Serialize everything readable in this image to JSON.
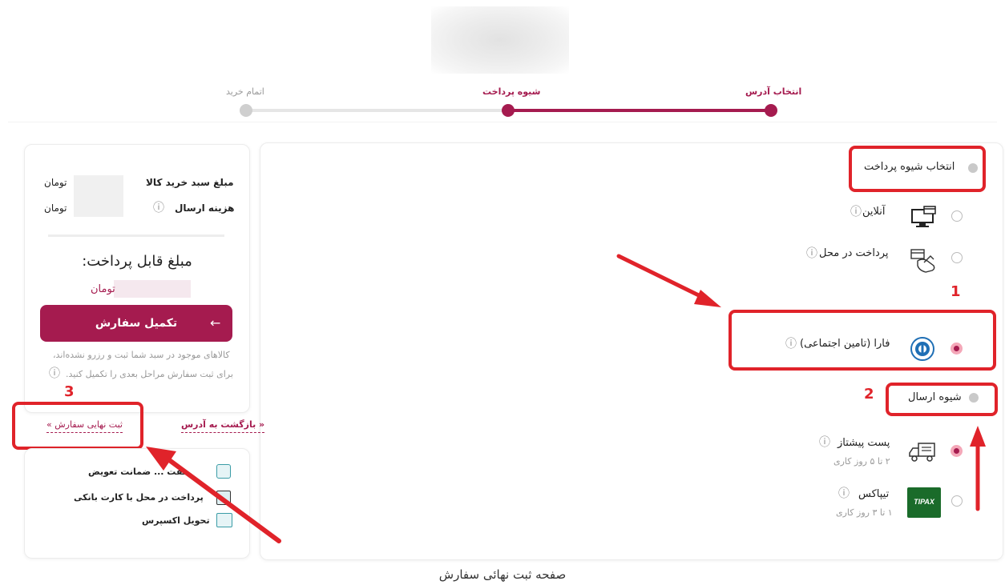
{
  "stepper": {
    "steps": [
      {
        "label": "انتخاب آدرس",
        "state": "done"
      },
      {
        "label": "شیوه پرداخت",
        "state": "current"
      },
      {
        "label": "اتمام خرید",
        "state": "pending"
      }
    ],
    "active_color": "#a51b4f",
    "pending_color": "#cfcfcf"
  },
  "payment": {
    "title": "انتخاب شیوه پرداخت",
    "options": [
      {
        "label": "آنلاین",
        "icon": "monitor-card-icon"
      },
      {
        "label": "پرداخت در محل",
        "icon": "hand-card-icon"
      },
      {
        "label": "فارا (تامین اجتماعی)",
        "icon": "tamin-logo-icon"
      }
    ]
  },
  "shipping": {
    "title": "شیوه ارسال",
    "options": [
      {
        "label": "پست پیشتاز",
        "sub": "۲ تا ۵ روز کاری",
        "icon": "truck-icon"
      },
      {
        "label": "تیپاکس",
        "sub": "۱ تا ۳ روز کاری",
        "icon": "tipax-logo-icon",
        "logo_text": "TIPAX"
      }
    ]
  },
  "summary": {
    "cart_label": "مبلغ سبد خرید کالا",
    "shipping_label": "هزینه ارسال",
    "currency": "تومان",
    "payable_title": "مبلغ قابل پرداخت:",
    "payable_currency": "تومان",
    "complete_button": "تکمیل سفارش",
    "note_line1": "کالاهای موجود در سبد شما ثبت و رزرو نشده‌اند،",
    "note_line2": "برای ثبت سفارش مراحل بعدی را تکمیل کنید."
  },
  "links": {
    "back": "« بازگشت به آدرس",
    "final": "ثبت نهایی سفارش »"
  },
  "features": [
    {
      "label": "هفت ... ضمانت تعویض",
      "icon": "seven-days-icon"
    },
    {
      "label": "پرداخت در محل با کارت بانکی",
      "icon": "card-reader-icon"
    },
    {
      "label": "تحویل اکسپرس",
      "icon": "express-box-icon"
    }
  ],
  "annotations": {
    "n1": "1",
    "n2": "2",
    "n3": "3",
    "color": "#e0232a"
  },
  "caption": "صفحه ثبت نهائی سفارش"
}
